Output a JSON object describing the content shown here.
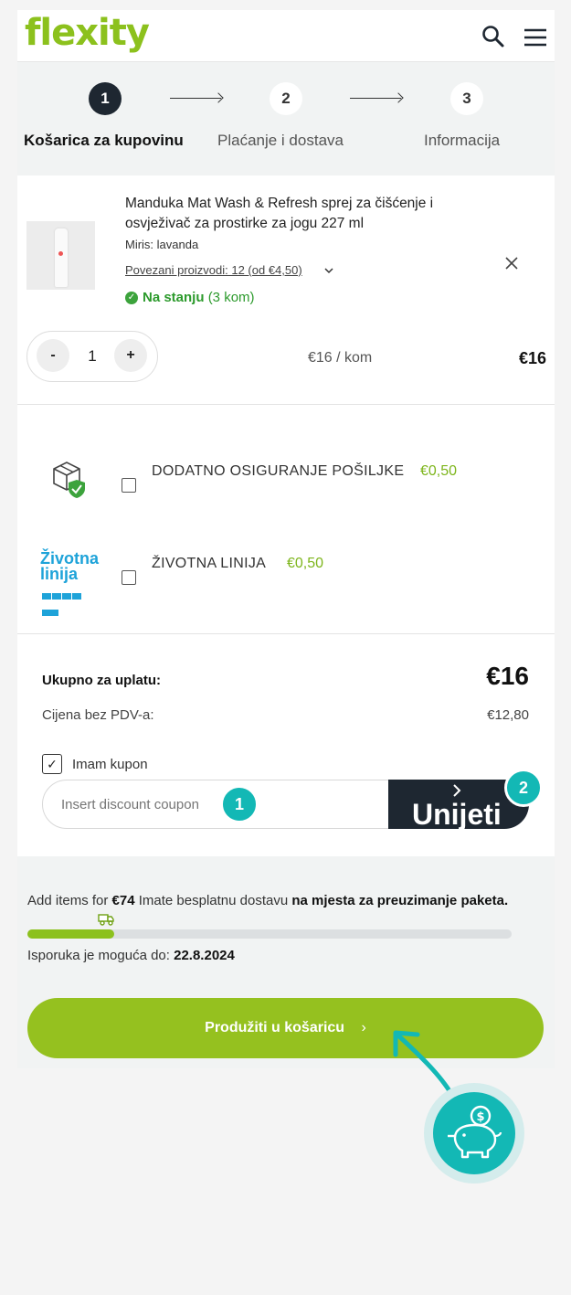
{
  "header": {
    "logo": "flexity",
    "search_icon": "search-icon",
    "menu_icon": "hamburger-menu-icon"
  },
  "steps": [
    {
      "number": "1",
      "label": "Košarica za kupovinu",
      "active": true
    },
    {
      "number": "2",
      "label": "Plaćanje i dostava",
      "active": false
    },
    {
      "number": "3",
      "label": "Informacija",
      "active": false
    }
  ],
  "product": {
    "name": "Manduka Mat Wash & Refresh sprej za čišćenje i osvježivač za prostirke za jogu 227 ml",
    "scent": "Miris: lavanda",
    "related": "Povezani proizvodi: 12 (od €4,50)",
    "stock_status": "Na stanju",
    "stock_count": "(3 kom)",
    "quantity": "1",
    "minus_label": "-",
    "plus_label": "+",
    "unit_price": "€16 / kom",
    "line_total": "€16"
  },
  "extras": [
    {
      "label": "DODATNO OSIGURANJE POŠILJKE",
      "price": "€0,50",
      "checked": false,
      "icon": "package-insurance-icon"
    },
    {
      "label": "ŽIVOTNA LINIJA",
      "price": "€0,50",
      "checked": false,
      "icon": "zivotna-linija-logo",
      "logo_line1": "Životna",
      "logo_line2": "linija"
    }
  ],
  "summary": {
    "total_label": "Ukupno za uplatu:",
    "total_value": "€16",
    "net_label": "Cijena bez PDV-a:",
    "net_value": "€12,80",
    "coupon_checkbox_label": "Imam kupon",
    "coupon_checked": true,
    "coupon_placeholder": "Insert discount coupon",
    "coupon_button": "Unijeti",
    "badge_1": "1",
    "badge_2": "2"
  },
  "delivery": {
    "prefix": "Add items for",
    "amount": "€74",
    "middle": "Imate besplatnu dostavu",
    "place": "na mjesta za preuzimanje paketa.",
    "progress": 0.18,
    "date_label": "Isporuka je moguća do:",
    "date_value": "22.8.2024",
    "cta_label": "Produžiti u košaricu"
  },
  "colors": {
    "brand_green": "#8cc11d",
    "dark": "#1e2731",
    "teal": "#13b8b5",
    "stock_green": "#2c9a2c"
  }
}
